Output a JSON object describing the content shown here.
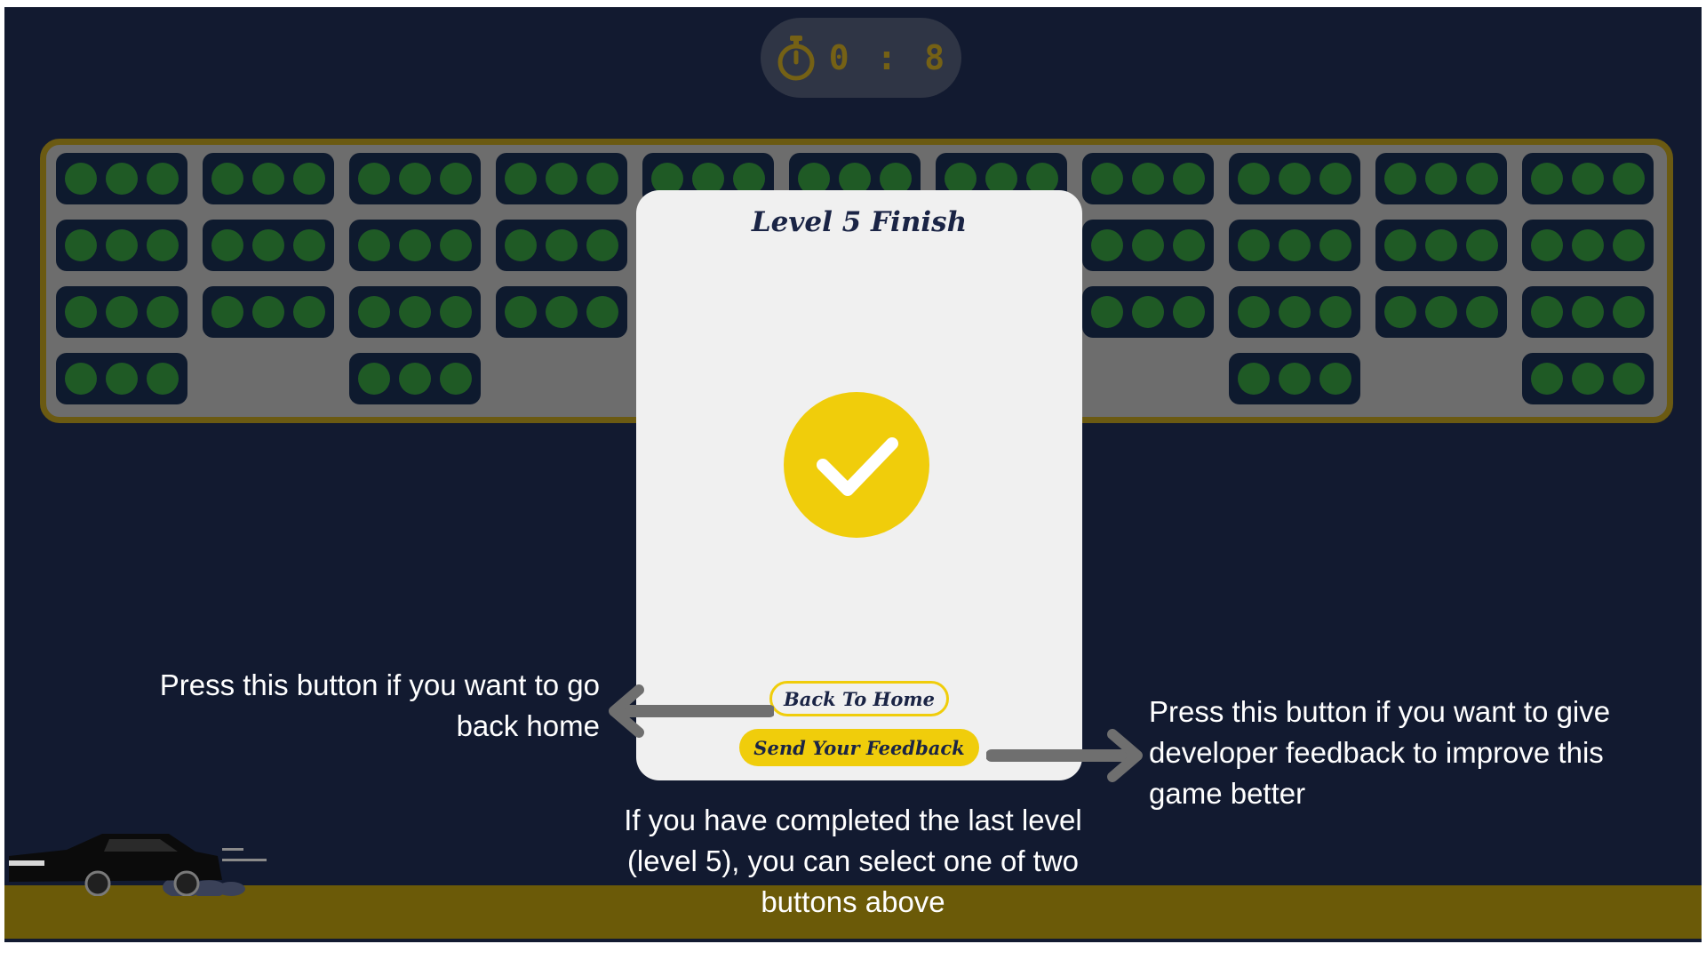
{
  "timer": {
    "value": "0 : 8",
    "icon": "stopwatch-icon",
    "color": "#756115"
  },
  "board": {
    "rows": [
      [
        true,
        true,
        true,
        true,
        true,
        true,
        true,
        true,
        true,
        true,
        true
      ],
      [
        true,
        true,
        true,
        true,
        true,
        true,
        true,
        true,
        true,
        true,
        true
      ],
      [
        true,
        true,
        true,
        true,
        true,
        true,
        true,
        true,
        true,
        true,
        true
      ],
      [
        true,
        false,
        true,
        false,
        false,
        false,
        false,
        false,
        true,
        false,
        true
      ]
    ],
    "dot_color": "#1f5a25"
  },
  "modal": {
    "title": "Level 5 Finish",
    "check_icon": "checkmark-icon",
    "accent": "#f0cd0b",
    "buttons": {
      "home_label": "Back To Home",
      "feedback_label": "Send Your Feedback"
    }
  },
  "annotations": {
    "left": "Press this button if you want to go back home",
    "right": "Press this button if you want to give developer feedback to improve this game better",
    "bottom": "If you have completed the last level (level 5), you can select one of two buttons above"
  },
  "colors": {
    "background": "#121a30",
    "ground": "#6b5a08",
    "arrow": "#6f6f6f"
  }
}
